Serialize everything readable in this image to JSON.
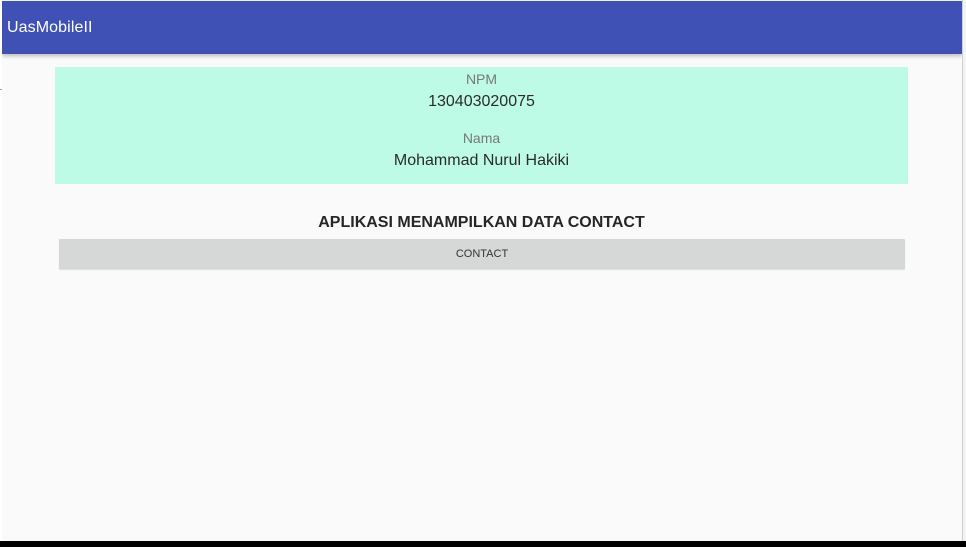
{
  "app_bar": {
    "title": "UasMobileII",
    "color": "#3f51b5"
  },
  "info_card": {
    "background": "#bdfbe7",
    "npm_label": "NPM",
    "npm_value": "130403020075",
    "nama_label": "Nama",
    "nama_value": "Mohammad Nurul Hakiki"
  },
  "main": {
    "heading": "APLIKASI MENAMPILKAN DATA CONTACT",
    "contact_button_label": "CONTACT"
  }
}
